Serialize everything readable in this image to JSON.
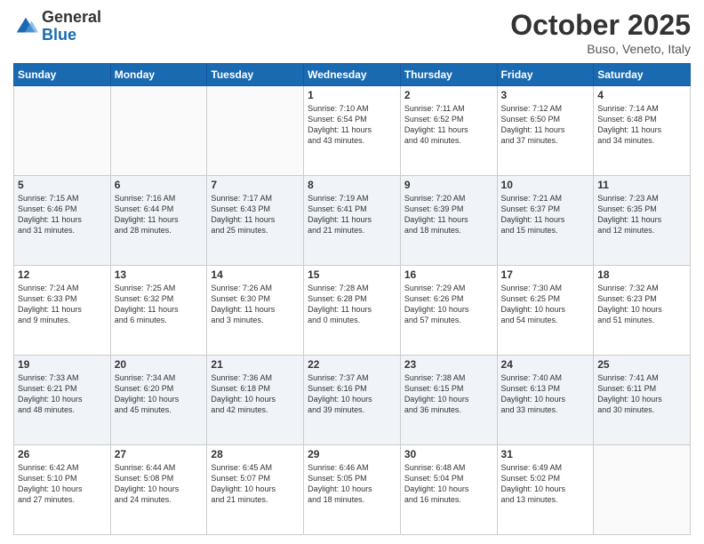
{
  "header": {
    "logo_general": "General",
    "logo_blue": "Blue",
    "month_title": "October 2025",
    "location": "Buso, Veneto, Italy"
  },
  "weekdays": [
    "Sunday",
    "Monday",
    "Tuesday",
    "Wednesday",
    "Thursday",
    "Friday",
    "Saturday"
  ],
  "weeks": [
    [
      {
        "day": "",
        "info": ""
      },
      {
        "day": "",
        "info": ""
      },
      {
        "day": "",
        "info": ""
      },
      {
        "day": "1",
        "info": "Sunrise: 7:10 AM\nSunset: 6:54 PM\nDaylight: 11 hours\nand 43 minutes."
      },
      {
        "day": "2",
        "info": "Sunrise: 7:11 AM\nSunset: 6:52 PM\nDaylight: 11 hours\nand 40 minutes."
      },
      {
        "day": "3",
        "info": "Sunrise: 7:12 AM\nSunset: 6:50 PM\nDaylight: 11 hours\nand 37 minutes."
      },
      {
        "day": "4",
        "info": "Sunrise: 7:14 AM\nSunset: 6:48 PM\nDaylight: 11 hours\nand 34 minutes."
      }
    ],
    [
      {
        "day": "5",
        "info": "Sunrise: 7:15 AM\nSunset: 6:46 PM\nDaylight: 11 hours\nand 31 minutes."
      },
      {
        "day": "6",
        "info": "Sunrise: 7:16 AM\nSunset: 6:44 PM\nDaylight: 11 hours\nand 28 minutes."
      },
      {
        "day": "7",
        "info": "Sunrise: 7:17 AM\nSunset: 6:43 PM\nDaylight: 11 hours\nand 25 minutes."
      },
      {
        "day": "8",
        "info": "Sunrise: 7:19 AM\nSunset: 6:41 PM\nDaylight: 11 hours\nand 21 minutes."
      },
      {
        "day": "9",
        "info": "Sunrise: 7:20 AM\nSunset: 6:39 PM\nDaylight: 11 hours\nand 18 minutes."
      },
      {
        "day": "10",
        "info": "Sunrise: 7:21 AM\nSunset: 6:37 PM\nDaylight: 11 hours\nand 15 minutes."
      },
      {
        "day": "11",
        "info": "Sunrise: 7:23 AM\nSunset: 6:35 PM\nDaylight: 11 hours\nand 12 minutes."
      }
    ],
    [
      {
        "day": "12",
        "info": "Sunrise: 7:24 AM\nSunset: 6:33 PM\nDaylight: 11 hours\nand 9 minutes."
      },
      {
        "day": "13",
        "info": "Sunrise: 7:25 AM\nSunset: 6:32 PM\nDaylight: 11 hours\nand 6 minutes."
      },
      {
        "day": "14",
        "info": "Sunrise: 7:26 AM\nSunset: 6:30 PM\nDaylight: 11 hours\nand 3 minutes."
      },
      {
        "day": "15",
        "info": "Sunrise: 7:28 AM\nSunset: 6:28 PM\nDaylight: 11 hours\nand 0 minutes."
      },
      {
        "day": "16",
        "info": "Sunrise: 7:29 AM\nSunset: 6:26 PM\nDaylight: 10 hours\nand 57 minutes."
      },
      {
        "day": "17",
        "info": "Sunrise: 7:30 AM\nSunset: 6:25 PM\nDaylight: 10 hours\nand 54 minutes."
      },
      {
        "day": "18",
        "info": "Sunrise: 7:32 AM\nSunset: 6:23 PM\nDaylight: 10 hours\nand 51 minutes."
      }
    ],
    [
      {
        "day": "19",
        "info": "Sunrise: 7:33 AM\nSunset: 6:21 PM\nDaylight: 10 hours\nand 48 minutes."
      },
      {
        "day": "20",
        "info": "Sunrise: 7:34 AM\nSunset: 6:20 PM\nDaylight: 10 hours\nand 45 minutes."
      },
      {
        "day": "21",
        "info": "Sunrise: 7:36 AM\nSunset: 6:18 PM\nDaylight: 10 hours\nand 42 minutes."
      },
      {
        "day": "22",
        "info": "Sunrise: 7:37 AM\nSunset: 6:16 PM\nDaylight: 10 hours\nand 39 minutes."
      },
      {
        "day": "23",
        "info": "Sunrise: 7:38 AM\nSunset: 6:15 PM\nDaylight: 10 hours\nand 36 minutes."
      },
      {
        "day": "24",
        "info": "Sunrise: 7:40 AM\nSunset: 6:13 PM\nDaylight: 10 hours\nand 33 minutes."
      },
      {
        "day": "25",
        "info": "Sunrise: 7:41 AM\nSunset: 6:11 PM\nDaylight: 10 hours\nand 30 minutes."
      }
    ],
    [
      {
        "day": "26",
        "info": "Sunrise: 6:42 AM\nSunset: 5:10 PM\nDaylight: 10 hours\nand 27 minutes."
      },
      {
        "day": "27",
        "info": "Sunrise: 6:44 AM\nSunset: 5:08 PM\nDaylight: 10 hours\nand 24 minutes."
      },
      {
        "day": "28",
        "info": "Sunrise: 6:45 AM\nSunset: 5:07 PM\nDaylight: 10 hours\nand 21 minutes."
      },
      {
        "day": "29",
        "info": "Sunrise: 6:46 AM\nSunset: 5:05 PM\nDaylight: 10 hours\nand 18 minutes."
      },
      {
        "day": "30",
        "info": "Sunrise: 6:48 AM\nSunset: 5:04 PM\nDaylight: 10 hours\nand 16 minutes."
      },
      {
        "day": "31",
        "info": "Sunrise: 6:49 AM\nSunset: 5:02 PM\nDaylight: 10 hours\nand 13 minutes."
      },
      {
        "day": "",
        "info": ""
      }
    ]
  ]
}
